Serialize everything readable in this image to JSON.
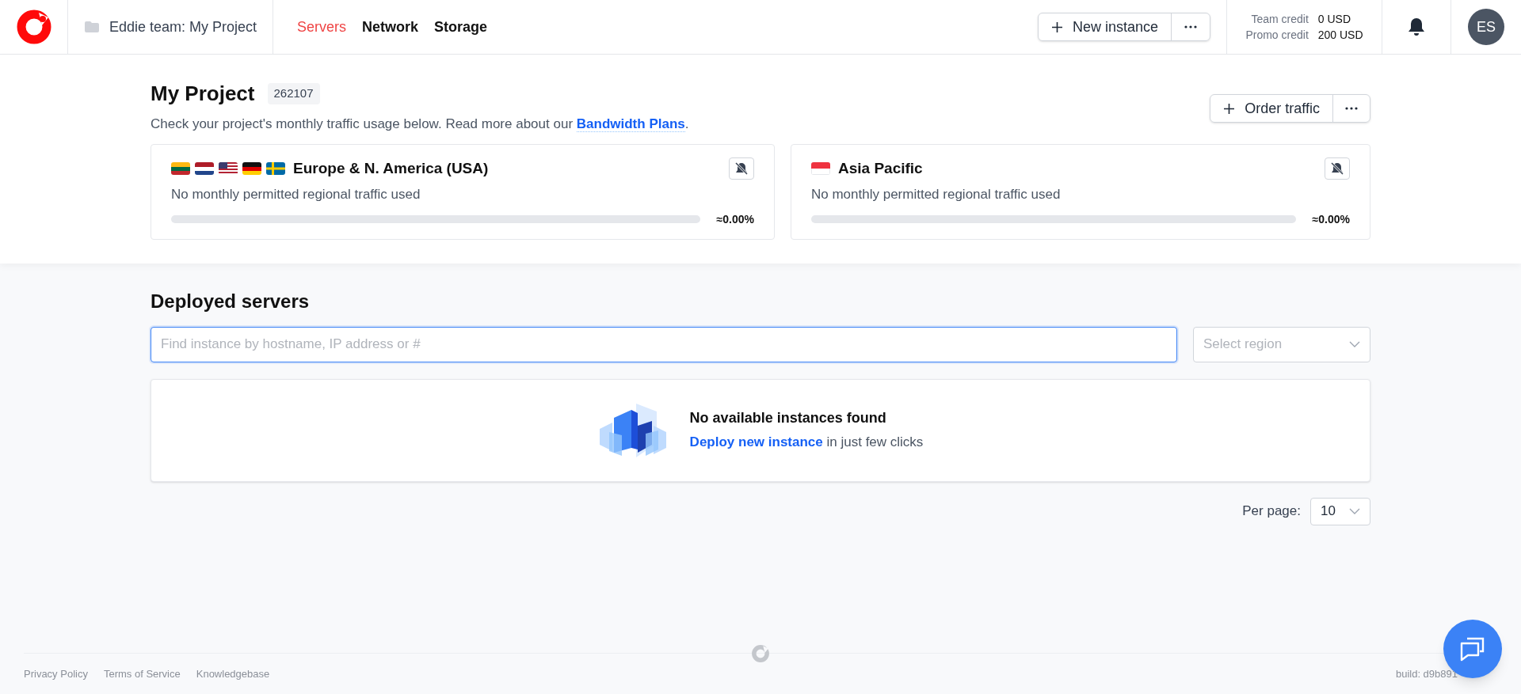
{
  "header": {
    "project": "Eddie team: My Project",
    "nav": [
      {
        "label": "Servers",
        "selected": true
      },
      {
        "label": "Network",
        "selected": false
      },
      {
        "label": "Storage",
        "selected": false
      }
    ],
    "new_instance": "New instance",
    "credits": [
      {
        "label": "Team credit",
        "value": "0 USD"
      },
      {
        "label": "Promo credit",
        "value": "200 USD"
      }
    ],
    "avatar": "ES"
  },
  "project": {
    "title": "My Project",
    "id": "262107",
    "description": "Check your project's monthly traffic usage below. Read more about our ",
    "link": "Bandwidth Plans",
    "after_link": ".",
    "order_traffic": "Order traffic",
    "regions": [
      {
        "name": "Europe & N. America (USA)",
        "flags": [
          {
            "kind": "lt"
          },
          {
            "kind": "nl"
          },
          {
            "kind": "us"
          },
          {
            "kind": "de"
          },
          {
            "kind": "se"
          }
        ],
        "usage": "No monthly permitted regional traffic used",
        "level": 0,
        "reading": "≈0.00%"
      },
      {
        "name": "Asia Pacific",
        "flags": [
          {
            "kind": "sg"
          }
        ],
        "usage": "No monthly permitted regional traffic used",
        "level": 0,
        "reading": "≈0.00%"
      }
    ]
  },
  "servers": {
    "title": "Deployed servers",
    "search": {
      "placeholder": "Find instance by hostname, IP address or #"
    },
    "region_select": {
      "placeholder": "Select region"
    },
    "empty": {
      "title": "No available instances found",
      "link": "Deploy new instance",
      "rest": " in just few clicks"
    },
    "per_page": {
      "label": "Per page:",
      "value": "10"
    }
  },
  "footer": {
    "links": [
      "Privacy Policy",
      "Terms of Service",
      "Knowledgebase"
    ],
    "build": "build: d9b891"
  }
}
